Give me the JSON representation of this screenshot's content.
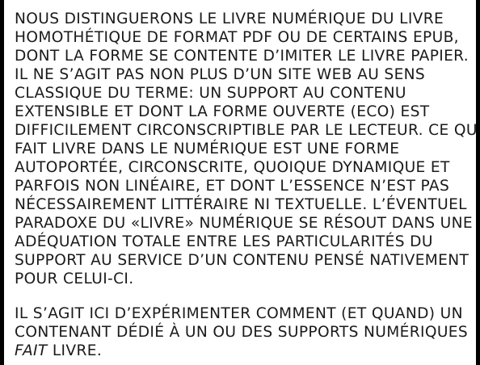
{
  "document": {
    "paragraphs": [
      {
        "lines": [
          "NOUS DISTINGUERONS LE LIVRE NUMÉRIQUE DU LIVRE",
          "HOMOTHÉTIQUE DE FORMAT PDF OU DE CERTAINS EPUB,",
          "DONT LA FORME SE CONTENTE D’IMITER LE LIVRE PAPIER.",
          "IL NE S’AGIT PAS NON PLUS D’UN SITE WEB AU SENS",
          "CLASSIQUE DU TERME: UN SUPPORT AU CONTENU",
          "EXTENSIBLE ET DONT LA FORME OUVERTE (ECO) EST",
          "DIFFICILEMENT CIRCONSCRIPTIBLE PAR LE LECTEUR. CE QUI",
          "FAIT LIVRE DANS LE NUMÉRIQUE EST UNE FORME",
          "AUTOPORTÉE, CIRCONSCRITE, QUOIQUE DYNAMIQUE ET",
          "PARFOIS NON LINÉAIRE, ET DONT L’ESSENCE N’EST PAS",
          "NÉCESSAIREMENT LITTÉRAIRE NI TEXTUELLE. L’ÉVENTUEL",
          "PARADOXE DU «LIVRE» NUMÉRIQUE SE RÉSOUT DANS UNE",
          "ADÉQUATION TOTALE ENTRE LES PARTICULARITÉS DU",
          "SUPPORT AU SERVICE D’UN CONTENU PENSÉ NATIVEMENT",
          "POUR CELUI-CI."
        ]
      },
      {
        "lines": [
          "IL S’AGIT ICI D’EXPÉRIMENTER COMMENT (ET QUAND) UN",
          "CONTENANT DÉDIÉ À UN OU DES SUPPORTS NUMÉRIQUES"
        ],
        "last_line_emphasis": "FAIT",
        "last_line_rest": " LIVRE."
      }
    ]
  },
  "colors": {
    "background": "#ffffff",
    "frame": "#000000",
    "text": "#1a1a1a"
  }
}
